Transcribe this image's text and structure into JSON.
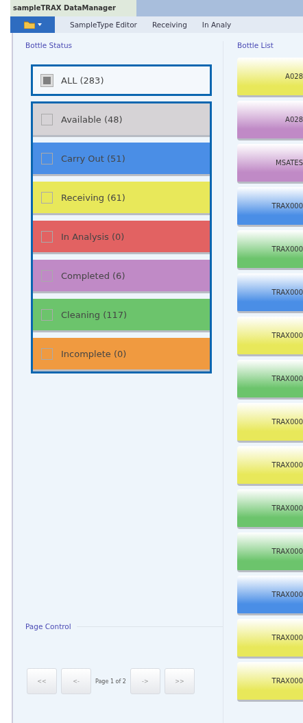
{
  "window": {
    "title": "sampleTRAX DataManager"
  },
  "menu": [
    {
      "label": "SampleType Editor"
    },
    {
      "label": "Receiving"
    },
    {
      "label": "In Analy"
    }
  ],
  "bottle_status": {
    "title": "Bottle Status",
    "all": {
      "label": "ALL (283)",
      "checked": true
    },
    "items": [
      {
        "label": "Available (48)",
        "checked": false,
        "color": "#d6d3d6"
      },
      {
        "label": "Carry Out (51)",
        "checked": false,
        "color": "#4a8ee6"
      },
      {
        "label": "Receiving (61)",
        "checked": false,
        "color": "#e8e85a"
      },
      {
        "label": "In Analysis (0)",
        "checked": false,
        "color": "#e26262"
      },
      {
        "label": "Completed (6)",
        "checked": false,
        "color": "#c08ac6"
      },
      {
        "label": "Cleaning (117)",
        "checked": false,
        "color": "#6cc46c"
      },
      {
        "label": "Incomplete (0)",
        "checked": false,
        "color": "#f09a40"
      }
    ]
  },
  "page_control": {
    "title": "Page Control",
    "first": "<<",
    "prev": "<-",
    "page": "Page 1 of 2",
    "next": "->",
    "last": ">>"
  },
  "bottle_list": {
    "title": "Bottle List",
    "bottles": [
      {
        "label": "A028",
        "color": "#e8e85a"
      },
      {
        "label": "A028",
        "color": "#c08ac6"
      },
      {
        "label": "MSATES",
        "color": "#c08ac6"
      },
      {
        "label": "TRAX000",
        "color": "#4a8ee6"
      },
      {
        "label": "TRAX000",
        "color": "#6cc46c"
      },
      {
        "label": "TRAX000",
        "color": "#4a8ee6"
      },
      {
        "label": "TRAX000",
        "color": "#e8e85a"
      },
      {
        "label": "TRAX000",
        "color": "#6cc46c"
      },
      {
        "label": "TRAX000",
        "color": "#e8e85a"
      },
      {
        "label": "TRAX000",
        "color": "#e8e85a"
      },
      {
        "label": "TRAX000",
        "color": "#6cc46c"
      },
      {
        "label": "TRAX000",
        "color": "#6cc46c"
      },
      {
        "label": "TRAX000",
        "color": "#4a8ee6"
      },
      {
        "label": "TRAX000",
        "color": "#e8e85a"
      },
      {
        "label": "TRAX000",
        "color": "#e8e85a"
      }
    ]
  }
}
